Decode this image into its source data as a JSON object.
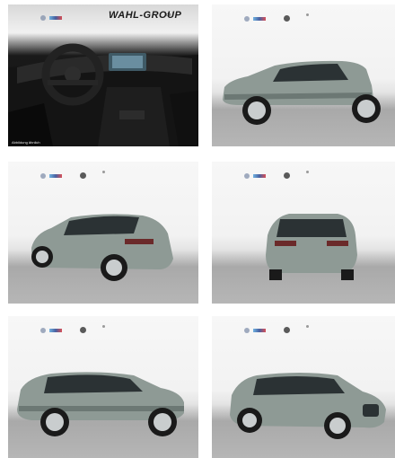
{
  "gallery": {
    "tiles": [
      {
        "id": "interior",
        "caption": "Abbildung ähnlich",
        "brand": "WAHL-GROUP",
        "brand_suffix": "de"
      },
      {
        "id": "side-left-front"
      },
      {
        "id": "rear-left-3q"
      },
      {
        "id": "rear"
      },
      {
        "id": "side-right-rear"
      },
      {
        "id": "front-right-3q"
      }
    ]
  },
  "colors": {
    "car_body": "#8e9a95",
    "car_shadow": "#6c7874",
    "glass": "#2b3234",
    "tire": "#1a1a1a",
    "rim": "#c9cdce"
  }
}
